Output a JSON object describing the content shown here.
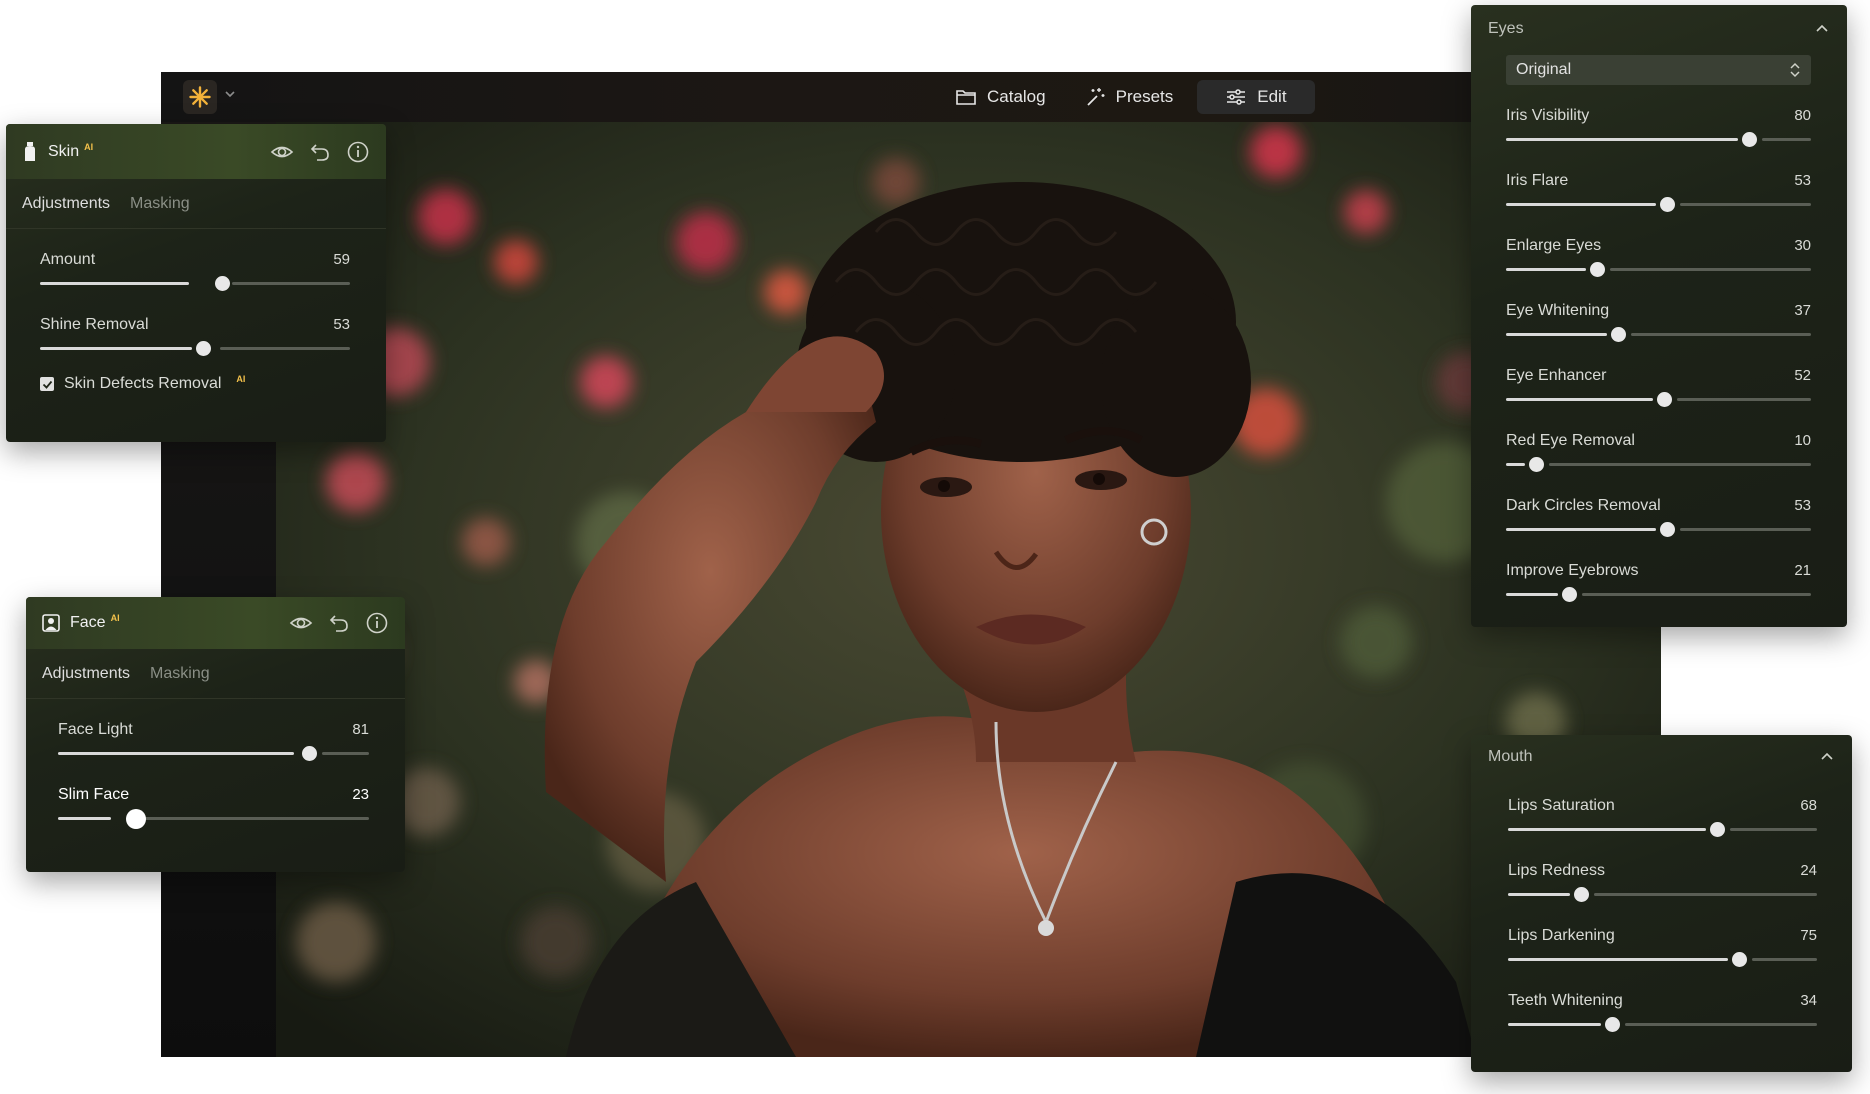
{
  "topbar": {
    "nav": [
      {
        "label": "Catalog",
        "icon": "folder-icon"
      },
      {
        "label": "Presets",
        "icon": "magic-wand-icon"
      },
      {
        "label": "Edit",
        "icon": "sliders-icon"
      }
    ],
    "active": "Edit",
    "logo_color": "#f3b23a"
  },
  "skin_panel": {
    "title": "Skin",
    "badge": "AI",
    "tabs": [
      "Adjustments",
      "Masking"
    ],
    "active_tab": "Adjustments",
    "sliders": [
      {
        "label": "Amount",
        "value": "59"
      },
      {
        "label": "Shine Removal",
        "value": "53"
      }
    ],
    "checkbox": {
      "label": "Skin Defects Removal",
      "badge": "AI",
      "checked": true
    }
  },
  "face_panel": {
    "title": "Face",
    "badge": "AI",
    "tabs": [
      "Adjustments",
      "Masking"
    ],
    "active_tab": "Adjustments",
    "sliders": [
      {
        "label": "Face Light",
        "value": "81"
      },
      {
        "label": "Slim Face",
        "value": "23"
      }
    ]
  },
  "eyes_panel": {
    "title": "Eyes",
    "dropdown": "Original",
    "sliders": [
      {
        "label": "Iris Visibility",
        "value": "80"
      },
      {
        "label": "Iris Flare",
        "value": "53"
      },
      {
        "label": "Enlarge Eyes",
        "value": "30"
      },
      {
        "label": "Eye Whitening",
        "value": "37"
      },
      {
        "label": "Eye Enhancer",
        "value": "52"
      },
      {
        "label": "Red Eye Removal",
        "value": "10"
      },
      {
        "label": "Dark Circles Removal",
        "value": "53"
      },
      {
        "label": "Improve Eyebrows",
        "value": "21"
      }
    ]
  },
  "mouth_panel": {
    "title": "Mouth",
    "sliders": [
      {
        "label": "Lips Saturation",
        "value": "68"
      },
      {
        "label": "Lips Redness",
        "value": "24"
      },
      {
        "label": "Lips Darkening",
        "value": "75"
      },
      {
        "label": "Teeth Whitening",
        "value": "34"
      }
    ]
  }
}
